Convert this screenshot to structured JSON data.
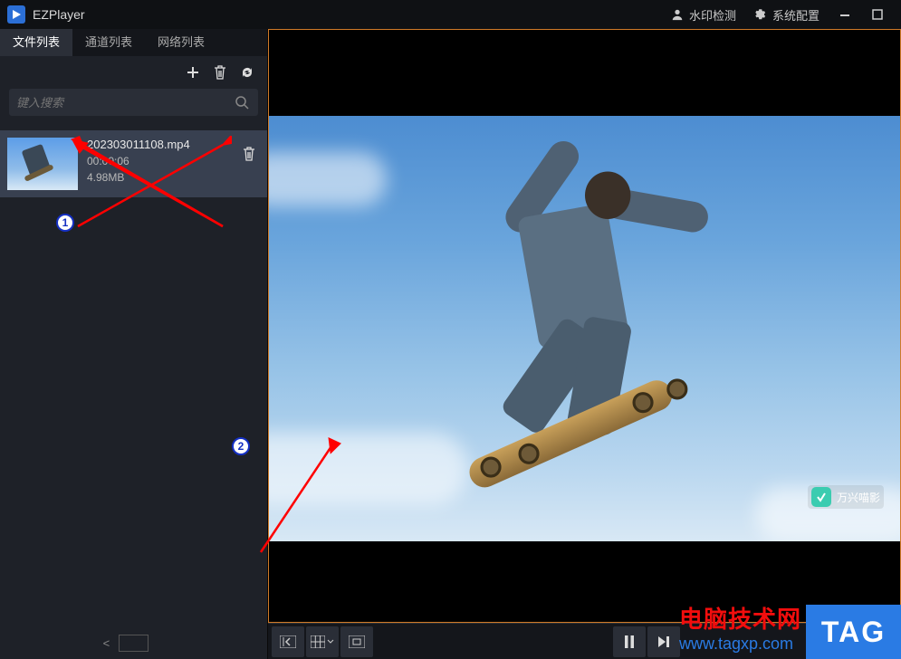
{
  "app": {
    "title": "EZPlayer"
  },
  "header": {
    "watermark_detect_label": "水印检测",
    "system_config_label": "系统配置"
  },
  "tabs": [
    {
      "label": "文件列表",
      "active": true
    },
    {
      "label": "通道列表",
      "active": false
    },
    {
      "label": "网络列表",
      "active": false
    }
  ],
  "search": {
    "placeholder": "键入搜索"
  },
  "files": [
    {
      "name": "202303011108.mp4",
      "duration": "00:00:06",
      "size": "4.98MB"
    }
  ],
  "pager": {
    "prev": "<",
    "page_input": "",
    "next": ">"
  },
  "video": {
    "watermark_text": "万兴喵影"
  },
  "controls": {
    "toggle_sidebar": "toggle-sidebar",
    "grid": "grid-layout",
    "fullscreen": "fullscreen",
    "pause": "pause",
    "next": "next"
  },
  "annotations": {
    "badge1": "1",
    "badge2": "2"
  },
  "overlay": {
    "site_name": "电脑技术网",
    "site_url": "www.tagxp.com",
    "tag": "TAG"
  }
}
